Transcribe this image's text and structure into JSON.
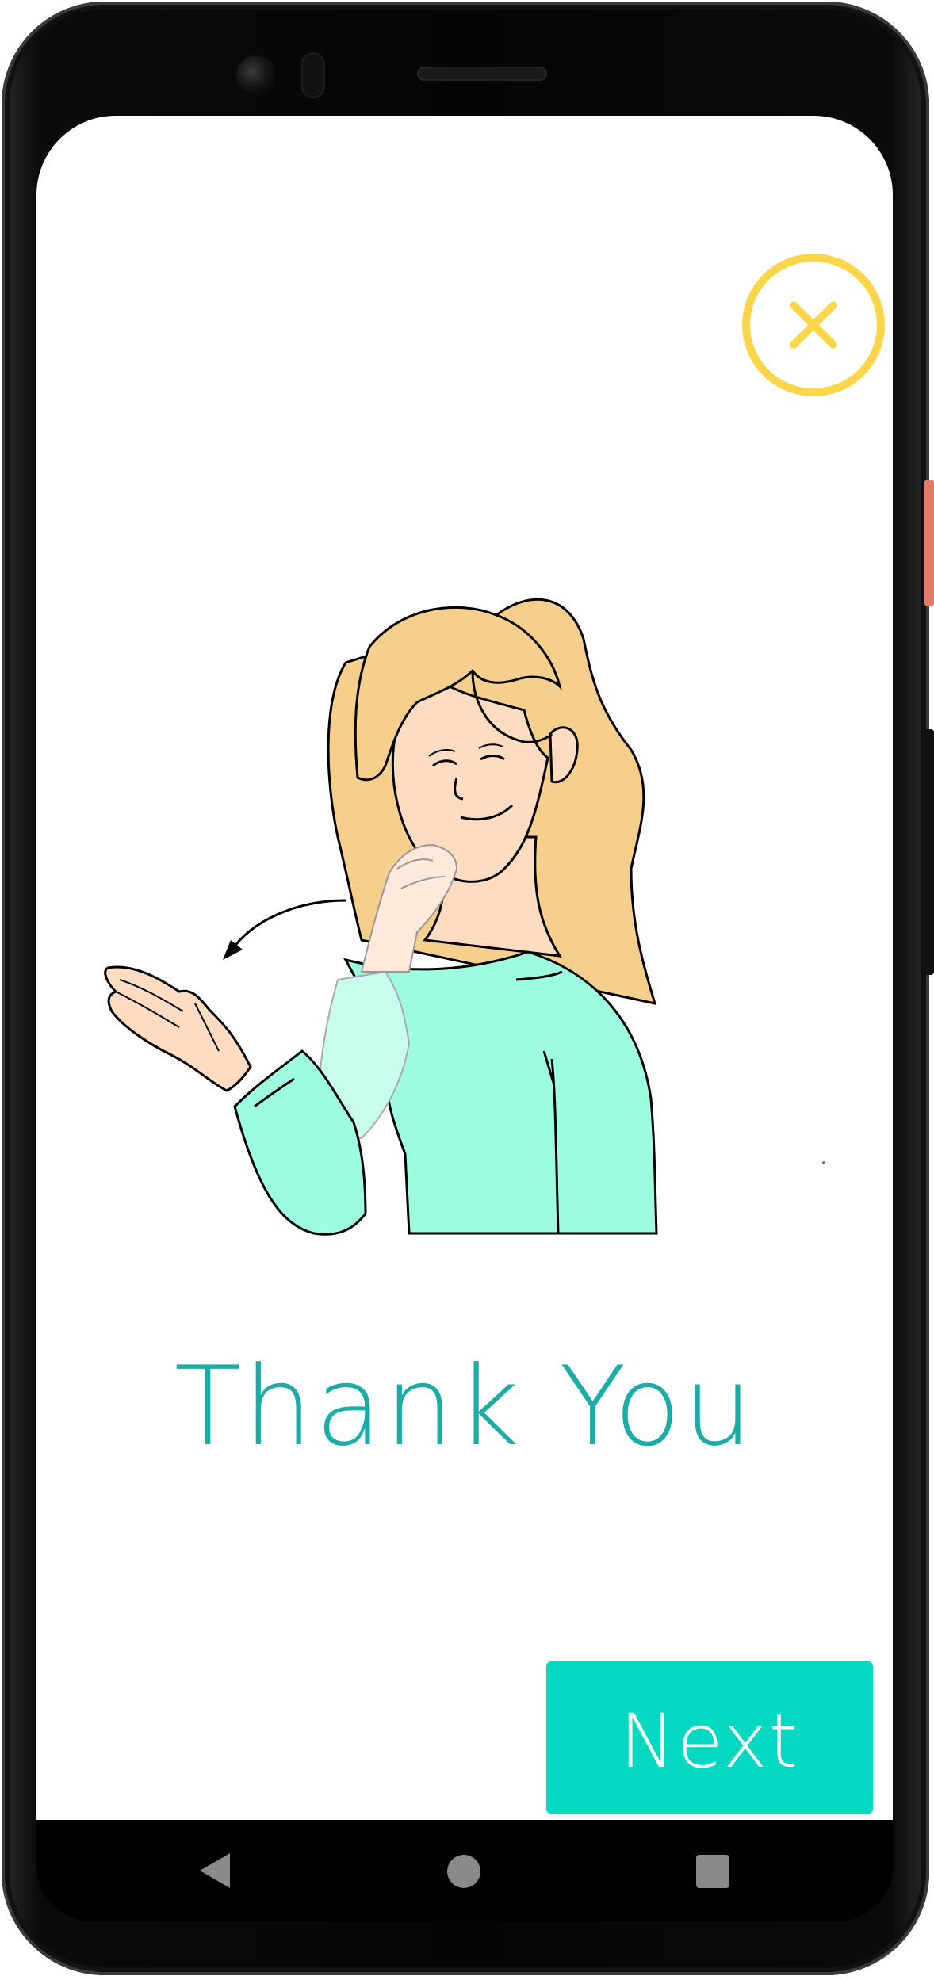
{
  "screen": {
    "title": "Thank You",
    "next_button_label": "Next"
  },
  "icons": {
    "close": "close-x-icon",
    "illustration": "sign-language-thank-you-illustration",
    "nav_back": "back-triangle-icon",
    "nav_home": "home-circle-icon",
    "nav_recents": "recents-square-icon"
  },
  "colors": {
    "title": "#1aada8",
    "next_button": "#03d8c3",
    "close_ring": "#fbd64a",
    "hair": "#f7cf8d",
    "skin": "#fddcc2",
    "shirt": "#9dfde0"
  }
}
